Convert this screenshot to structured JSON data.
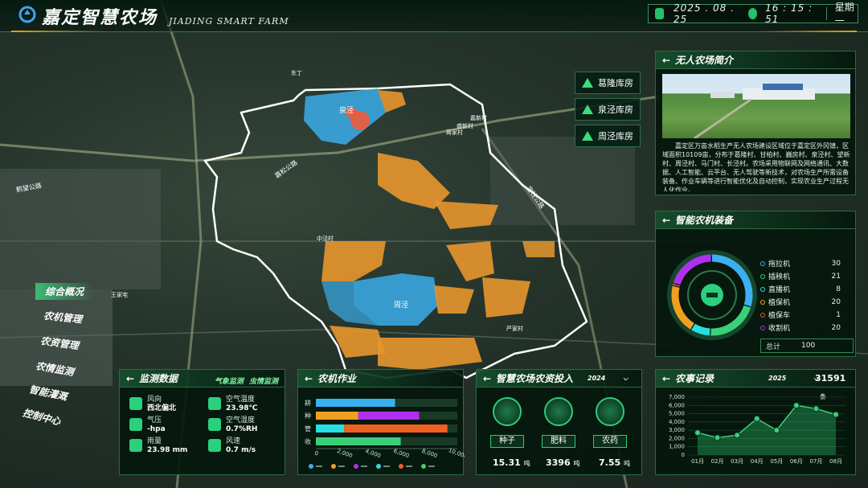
{
  "header": {
    "title": "嘉定智慧农场",
    "subtitle": "JIADING SMART FARM",
    "date": "2025 . 08 . 25",
    "time": "16 : 15 : 51",
    "weekday": "星期一"
  },
  "nav": {
    "items": [
      "综合概况",
      "农机管理",
      "农资管理",
      "农情监测",
      "智能灌溉",
      "控制中心"
    ]
  },
  "map": {
    "labels": {
      "quanjing": "泉泾",
      "zhoujing": "周泾",
      "zhongjingcun": "中泾村",
      "jiangcun": "蒋家村",
      "dongding": "东丁",
      "shengxin": "盛新村",
      "jiaxing": "嘉新村",
      "wangjia": "王家宅",
      "yanjia": "严家村",
      "road1": "鹤望公路",
      "road2": "嘉松公路",
      "road3": "宝钱公路"
    }
  },
  "stores": [
    "葛隆库房",
    "泉泾库房",
    "周泾库房"
  ],
  "intro": {
    "title": "无人农场简介",
    "text": "嘉定区万亩水稻生产无人农场建设区域位于嘉定区外冈镇，区域面积10109亩，分布于葛隆村、甘柏村、巍房村、泉泾村、望新村、周泾村、马门村、长泾村。农场采用物联网及网络通讯、大数据、人工智能、云平台、无人驾驶等新技术，对农场生产所需设备装备、作业车辆等进行智能优化及自动控制，实现农业生产过程无人化作业。"
  },
  "machinery": {
    "title": "智能农机装备",
    "items": [
      {
        "name": "拖拉机",
        "value": "30",
        "color": "#3ab0f0"
      },
      {
        "name": "插秧机",
        "value": "21",
        "color": "#3ad07a"
      },
      {
        "name": "直播机",
        "value": "8",
        "color": "#25e0e0"
      },
      {
        "name": "植保机",
        "value": "20",
        "color": "#f0a020"
      },
      {
        "name": "植保车",
        "value": "1",
        "color": "#f05030"
      },
      {
        "name": "收割机",
        "value": "20",
        "color": "#b030f0"
      }
    ],
    "total_label": "总计",
    "total_value": "100"
  },
  "monitor": {
    "title": "监测数据",
    "tab1": "气象监测",
    "tab2": "虫情监测",
    "items": [
      {
        "label": "风向",
        "value": "西北偏北"
      },
      {
        "label": "空气温度",
        "value": "23.98℃"
      },
      {
        "label": "气压",
        "value": "-hpa"
      },
      {
        "label": "空气湿度",
        "value": "0.7%RH"
      },
      {
        "label": "雨量",
        "value": "23.98 mm"
      },
      {
        "label": "风速",
        "value": "0.7 m/s"
      }
    ]
  },
  "farmwork": {
    "title": "农机作业",
    "categories": [
      "耕",
      "种",
      "管",
      "收"
    ],
    "xticks": [
      "0",
      "2,000",
      "4,000",
      "6,000",
      "8,000",
      "10,000"
    ]
  },
  "inputs": {
    "title": "智慧农场农资投入",
    "year": "2024",
    "items": [
      {
        "name": "种子",
        "value": "15.31",
        "unit": "吨"
      },
      {
        "name": "肥料",
        "value": "3396",
        "unit": "吨"
      },
      {
        "name": "农药",
        "value": "7.55",
        "unit": "吨"
      }
    ]
  },
  "records": {
    "title": "农事记录",
    "year": "2025",
    "count": "31591",
    "count_unit": "条"
  },
  "chart_data": [
    {
      "type": "bar",
      "stacked": true,
      "orientation": "horizontal",
      "categories": [
        "耕",
        "种",
        "管",
        "收"
      ],
      "series": [
        {
          "color": "#3ab0f0",
          "values": [
            5600,
            0,
            0,
            0
          ]
        },
        {
          "color": "#f0a020",
          "values": [
            0,
            3000,
            0,
            0
          ]
        },
        {
          "color": "#b030f0",
          "values": [
            0,
            4300,
            0,
            0
          ]
        },
        {
          "color": "#25e0e0",
          "values": [
            0,
            0,
            2000,
            0
          ]
        },
        {
          "color": "#f06020",
          "values": [
            0,
            0,
            7300,
            0
          ]
        },
        {
          "color": "#3ad07a",
          "values": [
            0,
            0,
            0,
            6000
          ]
        }
      ],
      "xlim": [
        0,
        10000
      ],
      "xticks": [
        "0",
        "2,000",
        "4,000",
        "6,000",
        "8,000",
        "10,000"
      ]
    },
    {
      "type": "pie",
      "categories": [
        "拖拉机",
        "插秧机",
        "直播机",
        "植保机",
        "植保车",
        "收割机"
      ],
      "values": [
        30,
        21,
        8,
        20,
        1,
        20
      ],
      "colors": [
        "#3ab0f0",
        "#3ad07a",
        "#25e0e0",
        "#f0a020",
        "#f05030",
        "#b030f0"
      ]
    },
    {
      "type": "area",
      "x": [
        "01月",
        "02月",
        "03月",
        "04月",
        "05月",
        "06月",
        "07月",
        "08月"
      ],
      "series": [
        {
          "values": [
            2700,
            2100,
            2400,
            4400,
            3000,
            6000,
            5600,
            4900
          ]
        }
      ],
      "ylim": [
        0,
        7000
      ],
      "yticks": [
        "0",
        "1,000",
        "2,000",
        "3,000",
        "4,000",
        "5,000",
        "6,000",
        "7,000"
      ]
    }
  ]
}
